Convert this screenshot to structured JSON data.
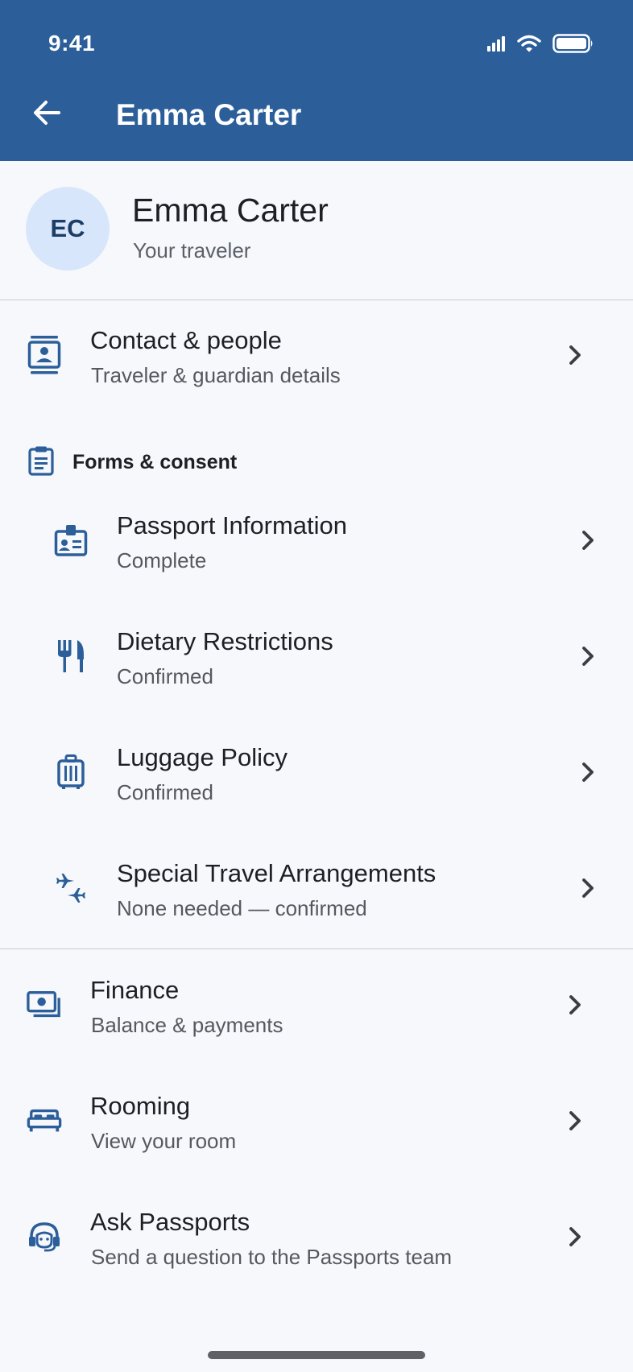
{
  "status_bar": {
    "time": "9:41"
  },
  "header": {
    "title": "Emma Carter",
    "back_icon": "arrow-left-icon"
  },
  "profile": {
    "initials": "EC",
    "name": "Emma Carter",
    "subtitle": "Your traveler"
  },
  "contact": {
    "title": "Contact & people",
    "subtitle": "Traveler & guardian details",
    "icon": "contact-card-icon"
  },
  "forms_section": {
    "label": "Forms & consent",
    "icon": "clipboard-icon",
    "items": [
      {
        "title": "Passport Information",
        "subtitle": "Complete",
        "icon": "id-badge-icon"
      },
      {
        "title": "Dietary Restrictions",
        "subtitle": "Confirmed",
        "icon": "utensils-icon"
      },
      {
        "title": "Luggage Policy",
        "subtitle": "Confirmed",
        "icon": "luggage-icon"
      },
      {
        "title": "Special Travel Arrangements",
        "subtitle": "None needed — confirmed",
        "icon": "connecting-flights-icon"
      }
    ]
  },
  "more_items": [
    {
      "title": "Finance",
      "subtitle": "Balance & payments",
      "icon": "payments-icon"
    },
    {
      "title": "Rooming",
      "subtitle": "View your room",
      "icon": "bed-icon"
    },
    {
      "title": "Ask Passports",
      "subtitle": "Send a question to the Passports team",
      "icon": "support-agent-icon"
    }
  ],
  "colors": {
    "header_bg": "#2c5f9a",
    "icon": "#2c5f9a",
    "background": "#f6f8fc",
    "avatar_bg": "#d8e6fb"
  }
}
